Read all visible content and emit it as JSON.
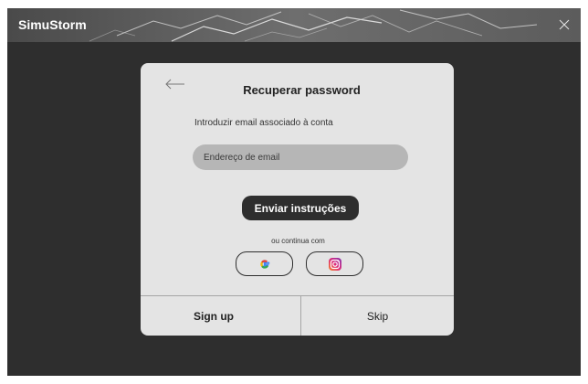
{
  "window": {
    "title": "SimuStorm",
    "close_icon": "close-icon"
  },
  "dialog": {
    "title": "Recuperar password",
    "back_icon": "arrow-left-icon",
    "instruction": "Introduzir email associado à conta",
    "email_placeholder": "Endereço de email",
    "email_value": "",
    "send_label": "Enviar instruções",
    "or_text": "ou continua com",
    "social": [
      {
        "name": "google",
        "icon": "google-icon"
      },
      {
        "name": "instagram",
        "icon": "instagram-icon"
      }
    ],
    "footer": {
      "signup_label": "Sign up",
      "skip_label": "Skip"
    }
  },
  "colors": {
    "background": "#2e2e2e",
    "titlebar": "#5a5a5a",
    "dialog": "#e4e4e4",
    "input": "#b6b6b6",
    "primary_button": "#2e2e2e"
  }
}
